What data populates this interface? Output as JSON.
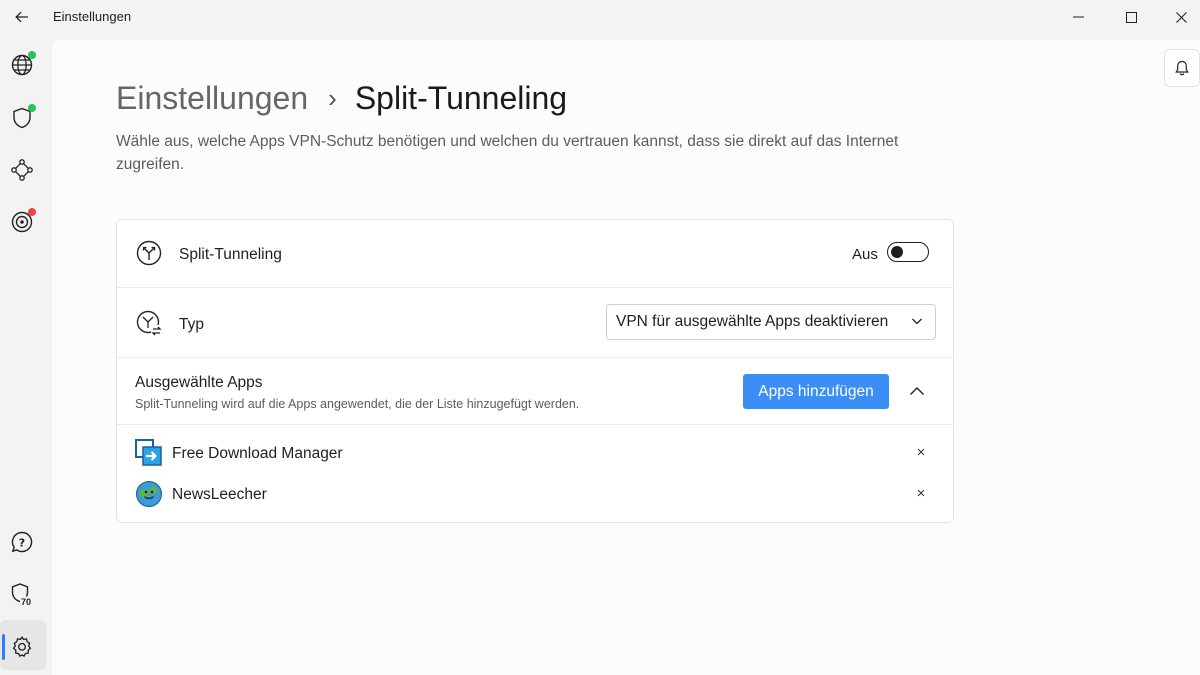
{
  "window": {
    "title": "Einstellungen",
    "back_icon": "back-arrow-icon"
  },
  "rail": {
    "items": [
      {
        "icon": "globe-icon",
        "status_dot": "#22c55e"
      },
      {
        "icon": "shield-icon",
        "status_dot": "#22c55e"
      },
      {
        "icon": "network-nodes-icon"
      },
      {
        "icon": "target-icon",
        "status_dot": "#ef4444"
      },
      {
        "icon": "help-chat-icon"
      },
      {
        "icon": "shield-badge-icon",
        "badge": "70"
      },
      {
        "icon": "gear-icon",
        "active": true
      }
    ]
  },
  "breadcrumb": {
    "parent": "Einstellungen",
    "separator": "›",
    "current": "Split-Tunneling"
  },
  "description": "Wähle aus, welche Apps VPN-Schutz benötigen und welchen du vertrauen kannst, dass sie direkt auf das Internet zugreifen.",
  "settings": {
    "split_tunneling": {
      "label": "Split-Tunneling",
      "state_label": "Aus",
      "enabled": false
    },
    "type": {
      "label": "Typ",
      "selected": "VPN für ausgewählte Apps deaktivieren"
    },
    "selected_apps": {
      "title": "Ausgewählte Apps",
      "subtitle": "Split-Tunneling wird auf die Apps angewendet, die der Liste hinzugefügt werden.",
      "add_button": "Apps hinzufügen",
      "apps": [
        {
          "name": "Free Download Manager",
          "remove": "×"
        },
        {
          "name": "NewsLeecher",
          "remove": "×"
        }
      ]
    }
  },
  "colors": {
    "accent": "#3b8ef5",
    "status_green": "#22c55e",
    "status_red": "#ef4444"
  }
}
